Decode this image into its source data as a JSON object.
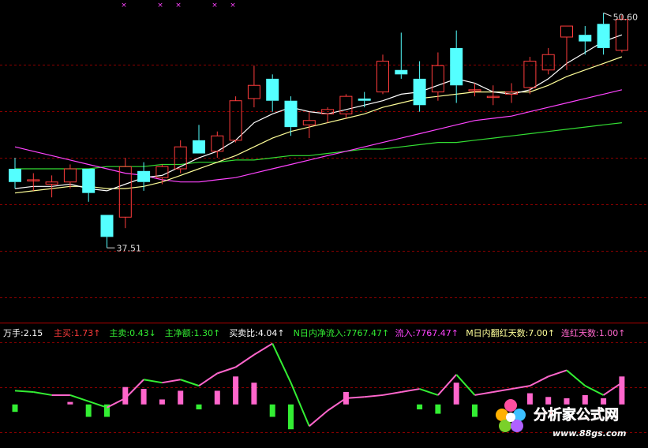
{
  "colors": {
    "background": "#000000",
    "grid": "#8b0000",
    "up_candle": "#ff3c3c",
    "down_candle": "#54ffff",
    "ma_short": "#ffffff",
    "ma_mid": "#ffff99",
    "ma_long": "#ff44ff",
    "ma_longest": "#33dd33",
    "indicator_line_up": "#ff66cc",
    "indicator_line_down": "#33ee33",
    "bar_pos": "#ff66cc",
    "bar_neg": "#33ee33",
    "markers": "#ff44ff"
  },
  "price_labels": {
    "high": "50.60",
    "low": "37.51"
  },
  "indicator_header": [
    {
      "text": "万手:2.15",
      "color": "#ffffff"
    },
    {
      "text": "主买:1.73",
      "arrow": "↑",
      "color": "#ff3c3c"
    },
    {
      "text": "主卖:0.43",
      "arrow": "↓",
      "color": "#33ee33"
    },
    {
      "text": "主净额:1.30",
      "arrow": "↑",
      "color": "#33ee33"
    },
    {
      "text": "买卖比:4.04",
      "arrow": "↑",
      "color": "#ffffff"
    },
    {
      "text": "N日内净流入:7767.47",
      "arrow": "↑",
      "color": "#33ee33"
    },
    {
      "text": "流入:7767.47",
      "arrow": "↑",
      "color": "#ff44ff"
    },
    {
      "text": "M日内翻红天数:7.00",
      "arrow": "↑",
      "color": "#ffff99"
    },
    {
      "text": "连红天数:1.00",
      "arrow": "↑",
      "color": "#ff66cc"
    }
  ],
  "watermark": {
    "title": "分析家公式网",
    "url": "www.88gs.com"
  },
  "chart_data": [
    {
      "type": "candlestick",
      "ylim": [
        37.0,
        50.9
      ],
      "candles": [
        {
          "o": 43.5,
          "h": 44.0,
          "l": 42.6,
          "c": 42.9
        },
        {
          "o": 43.0,
          "h": 43.3,
          "l": 42.5,
          "c": 43.0
        },
        {
          "o": 42.8,
          "h": 43.2,
          "l": 42.2,
          "c": 42.9
        },
        {
          "o": 42.9,
          "h": 43.7,
          "l": 42.6,
          "c": 43.5
        },
        {
          "o": 43.5,
          "h": 43.5,
          "l": 42.0,
          "c": 42.4
        },
        {
          "o": 41.4,
          "h": 41.4,
          "l": 39.9,
          "c": 40.4
        },
        {
          "o": 41.3,
          "h": 44.0,
          "l": 40.8,
          "c": 43.6
        },
        {
          "o": 43.4,
          "h": 43.8,
          "l": 42.5,
          "c": 42.9
        },
        {
          "o": 43.1,
          "h": 43.7,
          "l": 42.8,
          "c": 43.6
        },
        {
          "o": 43.5,
          "h": 44.8,
          "l": 43.3,
          "c": 44.5
        },
        {
          "o": 44.8,
          "h": 45.5,
          "l": 44.3,
          "c": 44.2
        },
        {
          "o": 44.3,
          "h": 45.2,
          "l": 44.0,
          "c": 45.0
        },
        {
          "o": 44.8,
          "h": 46.8,
          "l": 44.7,
          "c": 46.6
        },
        {
          "o": 46.7,
          "h": 48.2,
          "l": 46.3,
          "c": 47.3
        },
        {
          "o": 47.6,
          "h": 47.8,
          "l": 46.1,
          "c": 46.6
        },
        {
          "o": 46.6,
          "h": 46.8,
          "l": 45.0,
          "c": 45.4
        },
        {
          "o": 45.5,
          "h": 46.1,
          "l": 44.9,
          "c": 45.7
        },
        {
          "o": 46.0,
          "h": 46.3,
          "l": 45.6,
          "c": 46.2
        },
        {
          "o": 46.0,
          "h": 46.9,
          "l": 45.8,
          "c": 46.8
        },
        {
          "o": 46.7,
          "h": 47.0,
          "l": 46.3,
          "c": 46.6
        },
        {
          "o": 47.0,
          "h": 48.7,
          "l": 46.9,
          "c": 48.4
        },
        {
          "o": 48.0,
          "h": 49.7,
          "l": 47.6,
          "c": 47.8
        },
        {
          "o": 47.6,
          "h": 48.4,
          "l": 46.1,
          "c": 46.4
        },
        {
          "o": 47.0,
          "h": 48.8,
          "l": 46.6,
          "c": 48.2
        },
        {
          "o": 49.0,
          "h": 49.8,
          "l": 46.5,
          "c": 47.3
        },
        {
          "o": 47.1,
          "h": 47.4,
          "l": 46.8,
          "c": 47.1
        },
        {
          "o": 46.8,
          "h": 47.3,
          "l": 46.4,
          "c": 46.8
        },
        {
          "o": 46.9,
          "h": 47.4,
          "l": 46.5,
          "c": 47.0
        },
        {
          "o": 47.2,
          "h": 48.6,
          "l": 46.9,
          "c": 48.4
        },
        {
          "o": 48.0,
          "h": 49.0,
          "l": 47.8,
          "c": 48.7
        },
        {
          "o": 49.5,
          "h": 50.0,
          "l": 48.0,
          "c": 50.0
        },
        {
          "o": 49.6,
          "h": 50.0,
          "l": 48.7,
          "c": 49.3
        },
        {
          "o": 50.1,
          "h": 50.6,
          "l": 48.7,
          "c": 49.0
        },
        {
          "o": 48.9,
          "h": 50.5,
          "l": 48.8,
          "c": 50.3
        }
      ],
      "ma_short": [
        42.6,
        42.7,
        42.7,
        42.8,
        42.6,
        42.5,
        42.8,
        43.1,
        43.2,
        43.6,
        44.0,
        44.3,
        44.8,
        45.6,
        46.0,
        46.3,
        46.1,
        46.0,
        46.2,
        46.4,
        46.6,
        46.9,
        47.0,
        47.3,
        47.6,
        47.4,
        47.0,
        46.9,
        47.1,
        47.6,
        48.3,
        48.8,
        49.3,
        49.6
      ],
      "ma_mid": [
        42.4,
        42.5,
        42.6,
        42.7,
        42.7,
        42.6,
        42.6,
        42.7,
        42.9,
        43.2,
        43.5,
        43.8,
        44.1,
        44.5,
        44.9,
        45.2,
        45.4,
        45.6,
        45.8,
        46.0,
        46.3,
        46.5,
        46.7,
        46.8,
        46.9,
        47.0,
        47.0,
        47.0,
        47.0,
        47.3,
        47.7,
        48.0,
        48.3,
        48.6
      ],
      "ma_long": [
        44.5,
        44.3,
        44.1,
        43.9,
        43.7,
        43.5,
        43.3,
        43.2,
        43.0,
        42.9,
        42.9,
        43.0,
        43.1,
        43.3,
        43.5,
        43.7,
        43.9,
        44.1,
        44.3,
        44.5,
        44.7,
        44.9,
        45.1,
        45.3,
        45.5,
        45.7,
        45.8,
        45.9,
        46.1,
        46.3,
        46.5,
        46.7,
        46.9,
        47.1
      ],
      "ma_longest": [
        43.5,
        43.5,
        43.5,
        43.5,
        43.5,
        43.6,
        43.6,
        43.6,
        43.7,
        43.7,
        43.8,
        43.8,
        43.9,
        43.9,
        44.0,
        44.1,
        44.1,
        44.2,
        44.3,
        44.4,
        44.4,
        44.5,
        44.6,
        44.7,
        44.7,
        44.8,
        44.9,
        45.0,
        45.1,
        45.2,
        45.3,
        45.4,
        45.5,
        45.6
      ]
    },
    {
      "type": "bar",
      "ylim": [
        -6,
        10
      ],
      "bars": [
        -1.2,
        0,
        0,
        0.4,
        -2.0,
        -2.0,
        2.8,
        2.5,
        0.8,
        2.2,
        -0.8,
        2.2,
        4.5,
        3.5,
        -2.0,
        -4.0,
        0,
        0,
        2.0,
        0,
        0,
        0,
        -0.8,
        -1.5,
        3.5,
        -2.0,
        0,
        0,
        1.8,
        1.2,
        1.0,
        1.5,
        1.0,
        4.5
      ],
      "line": [
        2.2,
        2.0,
        1.5,
        1.5,
        0.5,
        -0.5,
        1.0,
        4.0,
        3.5,
        4.0,
        3.0,
        5.0,
        6.0,
        8.0,
        9.8,
        3.5,
        -3.5,
        -1.0,
        1.0,
        1.2,
        1.5,
        2.0,
        2.5,
        1.5,
        4.8,
        1.5,
        2.0,
        2.5,
        3.0,
        4.5,
        5.5,
        3.0,
        1.5,
        3.5
      ]
    }
  ]
}
